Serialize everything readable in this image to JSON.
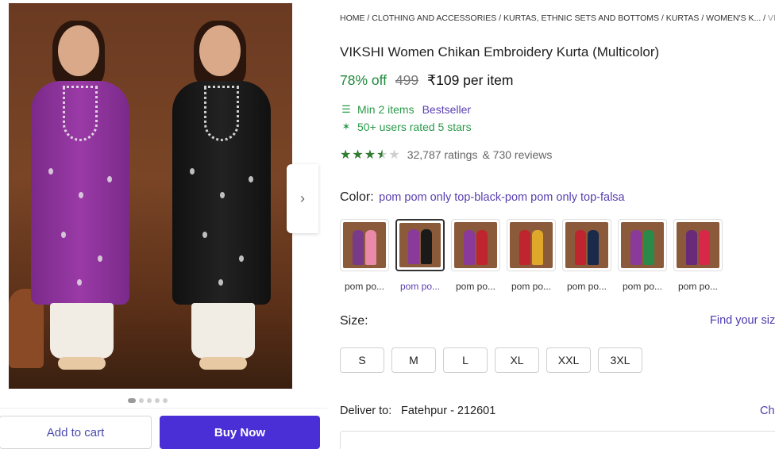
{
  "breadcrumb": {
    "items": [
      "HOME",
      "CLOTHING AND ACCESSORIES",
      "KURTAS, ETHNIC SETS AND BOTTOMS",
      "KURTAS",
      "WOMEN'S K..."
    ],
    "last": "VIKSHI",
    "separator": " / "
  },
  "product": {
    "title": "VIKSHI Women Chikan Embroidery Kurta (Multicolor)",
    "discount": "78% off",
    "mrp": "499",
    "price": "₹109 per item",
    "min_items": "Min 2 items",
    "bestseller": "Bestseller",
    "rated": "50+ users rated 5 stars",
    "rating_stars": 3.5,
    "ratings_count": "32,787 ratings",
    "reviews_count": "& 730 reviews"
  },
  "color": {
    "label": "Color:",
    "value": "pom pom only top-black-pom pom only top-falsa",
    "swatches": [
      {
        "label": "pom po...",
        "colors": [
          "#7a3a8a",
          "#e88aa8"
        ],
        "active": false
      },
      {
        "label": "pom po...",
        "colors": [
          "#8a3a9a",
          "#1a1a1a"
        ],
        "active": true
      },
      {
        "label": "pom po...",
        "colors": [
          "#8a3a9a",
          "#c0242e"
        ],
        "active": false
      },
      {
        "label": "pom po...",
        "colors": [
          "#c0242e",
          "#e0a82a"
        ],
        "active": false
      },
      {
        "label": "pom po...",
        "colors": [
          "#c0242e",
          "#1a2a4a"
        ],
        "active": false
      },
      {
        "label": "pom po...",
        "colors": [
          "#8a3a9a",
          "#2a8a4a"
        ],
        "active": false
      },
      {
        "label": "pom po...",
        "colors": [
          "#6a2a7a",
          "#d8284a"
        ],
        "active": false
      }
    ]
  },
  "size": {
    "label": "Size:",
    "guide": "Find your size",
    "options": [
      "S",
      "M",
      "L",
      "XL",
      "XXL",
      "3XL"
    ]
  },
  "delivery": {
    "label": "Deliver to:",
    "location": "Fatehpur - 212601",
    "change": "Change"
  },
  "actions": {
    "add_to_cart": "Add to cart",
    "buy_now": "Buy Now",
    "next_icon": "chevron-right-icon"
  },
  "gallery": {
    "pages": 5,
    "current": 1
  },
  "colors": {
    "accent": "#4b2fd6",
    "discount": "#1f8a3a",
    "link": "#5a3fb0"
  }
}
